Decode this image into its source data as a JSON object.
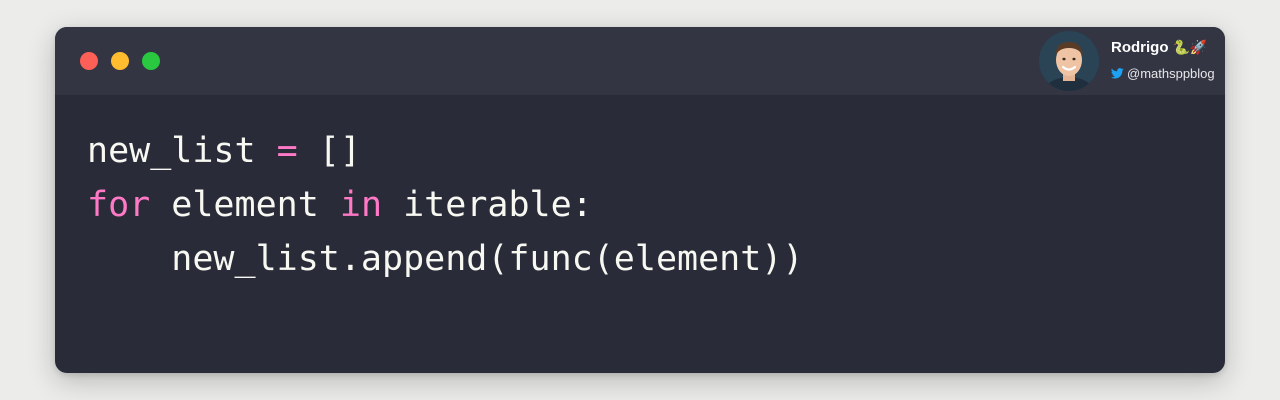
{
  "window": {
    "background": "#292b39",
    "titlebar_background": "#333543",
    "buttons": [
      {
        "name": "close",
        "color": "#fe5f57"
      },
      {
        "name": "minimize",
        "color": "#febc2e"
      },
      {
        "name": "maximize",
        "color": "#29c840"
      }
    ]
  },
  "author": {
    "name": "Rodrigo",
    "emoji": "🐍🚀",
    "handle": "@mathsppblog",
    "handle_icon": "twitter-bird-icon",
    "handle_icon_color": "#1da1f2"
  },
  "code": {
    "language": "python",
    "keyword_color": "#ff79c6",
    "text_color": "#f8f8f2",
    "lines": [
      {
        "tokens": [
          {
            "text": "new_list ",
            "kind": "txt"
          },
          {
            "text": "=",
            "kind": "op"
          },
          {
            "text": " []",
            "kind": "txt"
          }
        ]
      },
      {
        "tokens": [
          {
            "text": "for",
            "kind": "kw"
          },
          {
            "text": " element ",
            "kind": "txt"
          },
          {
            "text": "in",
            "kind": "kw"
          },
          {
            "text": " iterable:",
            "kind": "txt"
          }
        ]
      },
      {
        "tokens": [
          {
            "text": "    new_list.append(func(element))",
            "kind": "txt"
          }
        ]
      }
    ]
  }
}
